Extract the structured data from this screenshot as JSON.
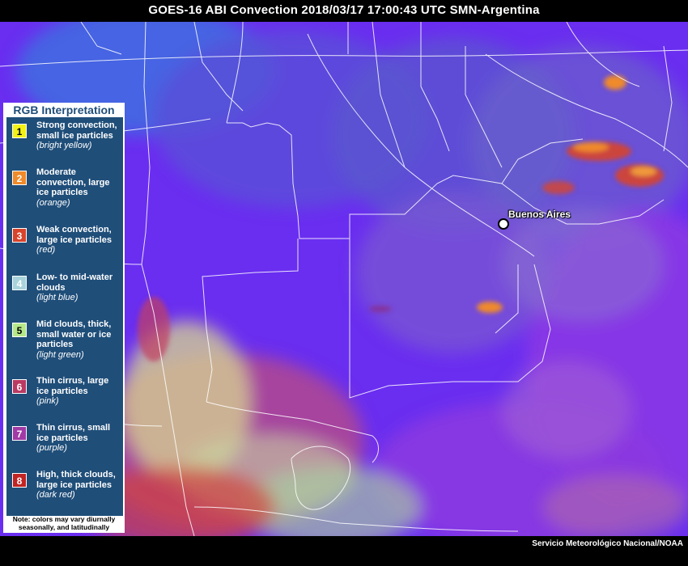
{
  "title": "GOES-16 ABI Convection 2018/03/17 17:00:43 UTC SMN-Argentina",
  "credit": "Servicio Meteorológico Nacional/NOAA",
  "city": {
    "name": "Buenos Aires"
  },
  "legend": {
    "heading": "RGB Interpretation",
    "items": [
      {
        "num": "1",
        "text": "Strong convection, small ice particles",
        "note": "(bright yellow)",
        "color": "#f2f218",
        "textColor": "#000000"
      },
      {
        "num": "2",
        "text": "Moderate convection, large ice particles",
        "note": "(orange)",
        "color": "#f08a2a",
        "textColor": "#ffffff"
      },
      {
        "num": "3",
        "text": "Weak convection, large ice particles",
        "note": "(red)",
        "color": "#d7442c",
        "textColor": "#ffffff"
      },
      {
        "num": "4",
        "text": "Low- to mid-water clouds",
        "note": "(light blue)",
        "color": "#a9d3dc",
        "textColor": "#ffffff"
      },
      {
        "num": "5",
        "text": "Mid clouds, thick, small water or ice particles",
        "note": "(light green)",
        "color": "#b6e88a",
        "textColor": "#000000"
      },
      {
        "num": "6",
        "text": "Thin cirrus, large ice particles",
        "note": "(pink)",
        "color": "#b93a62",
        "textColor": "#ffffff"
      },
      {
        "num": "7",
        "text": "Thin cirrus, small ice particles",
        "note": "(purple)",
        "color": "#a13aa6",
        "textColor": "#ffffff"
      },
      {
        "num": "8",
        "text": "High, thick clouds, large ice particles",
        "note": "(dark red)",
        "color": "#c22424",
        "textColor": "#ffffff"
      }
    ],
    "note": "Note: colors may vary diurnally seasonally, and latitudinally"
  },
  "colors": {
    "background": "#000000",
    "surface_purple": "#6a2ef0",
    "ocean_violet": "#8a33e6",
    "north_blue": "#4a52d8",
    "boundary_lines": "#ffffff",
    "legend_panel": "#1f4e79"
  }
}
